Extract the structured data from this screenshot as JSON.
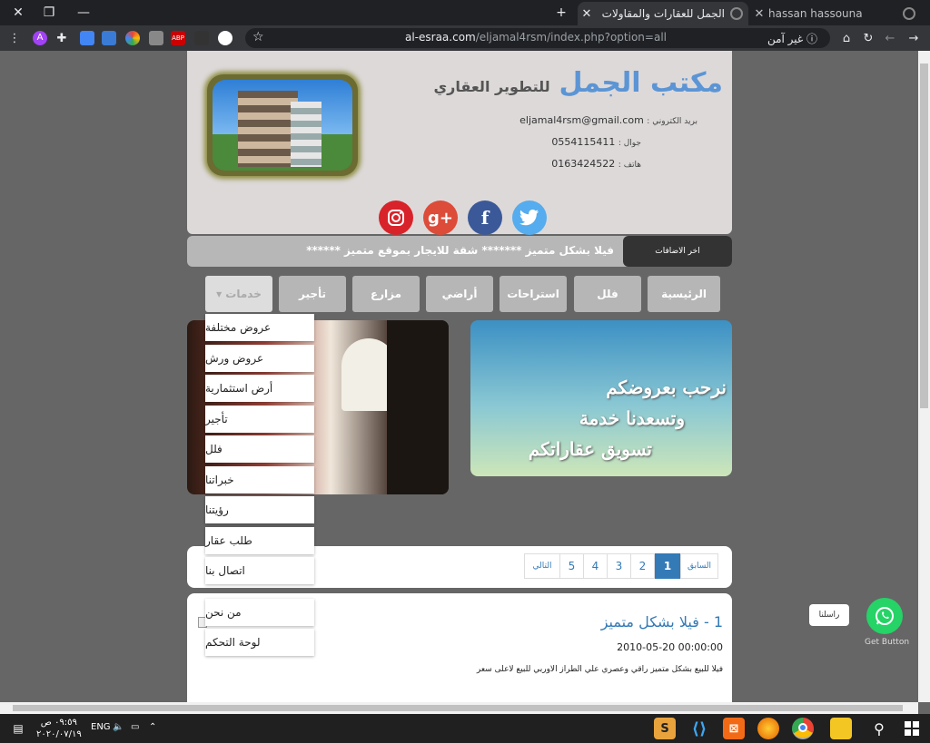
{
  "browser": {
    "tabs": [
      {
        "title": "hassan hassouna",
        "active": false
      },
      {
        "title": "الجمل للعقارات والمقاولات",
        "active": true
      }
    ],
    "new_tab": "+",
    "url_prefix": "al-esraa.com",
    "url_path": "/eljamal4rsm/index.php?option=all",
    "security_label": "غير آمن",
    "window_controls": {
      "close": "✕",
      "restore": "❐",
      "minimize": "—"
    }
  },
  "header": {
    "brand_main": "مكتب الجمل",
    "brand_sub": "للتطوير العقاري",
    "email_label": "بريد الكتروني :",
    "email": "eljamal4rsm@gmail.com",
    "mobile_label": "جوال :",
    "mobile": "0554115411",
    "phone_label": "هاتف :",
    "phone": "0163424522",
    "social": [
      "instagram-icon",
      "google-plus-icon",
      "facebook-icon",
      "twitter-icon"
    ]
  },
  "ticker": {
    "latest_label": "اخر الاضافات",
    "text": "فيلا بشكل متميز  *******  شقة للايجار بموقع متميز  ******"
  },
  "nav": [
    {
      "label": "الرئيسية"
    },
    {
      "label": "فلل"
    },
    {
      "label": "استراحات"
    },
    {
      "label": "أراضي"
    },
    {
      "label": "مزارع"
    },
    {
      "label": "تأجير"
    },
    {
      "label": "خدمات ▾"
    }
  ],
  "dropdown": [
    "عروض مختلفة",
    "عروض ورش",
    "أرض استثمارية",
    "تأجير",
    "فلل",
    "خبراتنا",
    "رؤيتنا",
    "طلب عقار",
    "اتصال بنا",
    "من نحن",
    "لوحة التحكم"
  ],
  "welcome": {
    "line1": "نرحب بعروضكم",
    "line2": "وتسعدنا خدمة",
    "line3": "تسويق عقاراتكم"
  },
  "pagination": {
    "prev": "السابق",
    "pages": [
      "1",
      "2",
      "3",
      "4",
      "5"
    ],
    "active_page": "1",
    "next": "التالي"
  },
  "post": {
    "title": "1 - فيلا بشكل متميز",
    "date": "2010-05-20 00:00:00",
    "body": "فيلا للبيع بشكل متميز راقي وعصري علي الطراز الاوربي للبيع لاعلى سعر"
  },
  "whatsapp": {
    "bubble": "راسلنا",
    "caption": "Get Button"
  },
  "taskbar": {
    "time": "٠٩:٥٩ ص",
    "date": "٢٠٢٠/٠٧/١٩",
    "lang": "ENG"
  },
  "colors": {
    "brand_blue": "#5b95d5",
    "link_blue": "#337ab7",
    "whatsapp_green": "#25d366"
  }
}
